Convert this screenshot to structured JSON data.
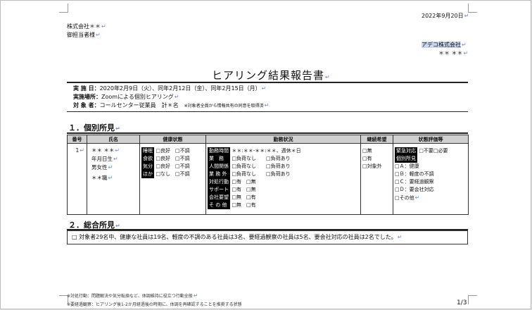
{
  "header": {
    "date": "2022年9月20日",
    "to_company": "株式会社＊＊",
    "to_person": "御担当者様",
    "from_company": "アデコ株式会社",
    "from_person": "＊＊ ＊＊"
  },
  "title": "ヒアリング結果報告書",
  "info": {
    "date_label": "実 施 日：",
    "date_value": "2020年2月9日（火）、同年2月12日（金）、同年2月15日（月）",
    "place_label": "実施場所：",
    "place_value": "Zoomによる個別ヒアリング",
    "target_label": "対 象 者：",
    "target_value": "コールセンター従業員　計＊名",
    "target_note": "※対象者全員から情報共有の同意を取得済"
  },
  "section1": {
    "heading": "１．個別所見"
  },
  "table": {
    "headers": [
      "番号",
      "氏名",
      "健康状態",
      "勤務状況",
      "継続希望",
      "状態評価等"
    ],
    "row": {
      "number": "1",
      "name": "＊＊ ＊＊",
      "birth": "年月日生",
      "gender": "男女性",
      "job": "＊＊職",
      "health": {
        "labels": [
          "睡眠",
          "食欲",
          "気分",
          "ほか"
        ],
        "rows": [
          [
            "□良好",
            "□不調"
          ],
          [
            "□良好",
            "□不調"
          ],
          [
            "□良好",
            "□不調"
          ],
          [
            "□なし",
            "□不調"
          ]
        ]
      },
      "work": {
        "labels": [
          "勤務時間",
          "業　務",
          "人間関係",
          "業 務 外",
          "対処行動",
          "サポート",
          "会社要望",
          "そ の 他"
        ],
        "rows": [
          [
            "＊＊:＊＊-＊＊:＊＊、週休＊日"
          ],
          [
            "□負荷なし",
            "□負荷あり"
          ],
          [
            "□負荷なし",
            "□負荷あり"
          ],
          [
            "□負荷なし",
            "□負荷あり"
          ],
          [
            "□有",
            "□無"
          ],
          [
            "□有",
            "□無"
          ],
          [
            "□無",
            "□有"
          ],
          [
            "□無",
            "□有"
          ]
        ]
      },
      "continue": [
        "□無",
        "□有",
        "□対象外"
      ],
      "eval": {
        "label1": "緊急対応",
        "opts1": [
          "□不要",
          "□必要"
        ],
        "label2": "個別所見",
        "items": [
          "□Ａ：健康",
          "□Ｂ：軽度の不調",
          "□Ｃ：要経過観察",
          "□Ｄ：要会社対応",
          "□その他"
        ]
      }
    }
  },
  "section2": {
    "heading": "２．総合所見",
    "text": "□ 対象者29名中、健康な社員は19名、軽度の不調のある社員は3名、要経過観察の社員は5名、要会社対応の社員は2名でした。"
  },
  "footer": {
    "note1": "※対処行動：問題解決や気分転換など、体調維持に役立つ行動全般",
    "note2": "※要経過観察：ヒアリング後1-2か月経過後の時期に、体調を再確認することを推奨する状態",
    "page": "1/3"
  }
}
